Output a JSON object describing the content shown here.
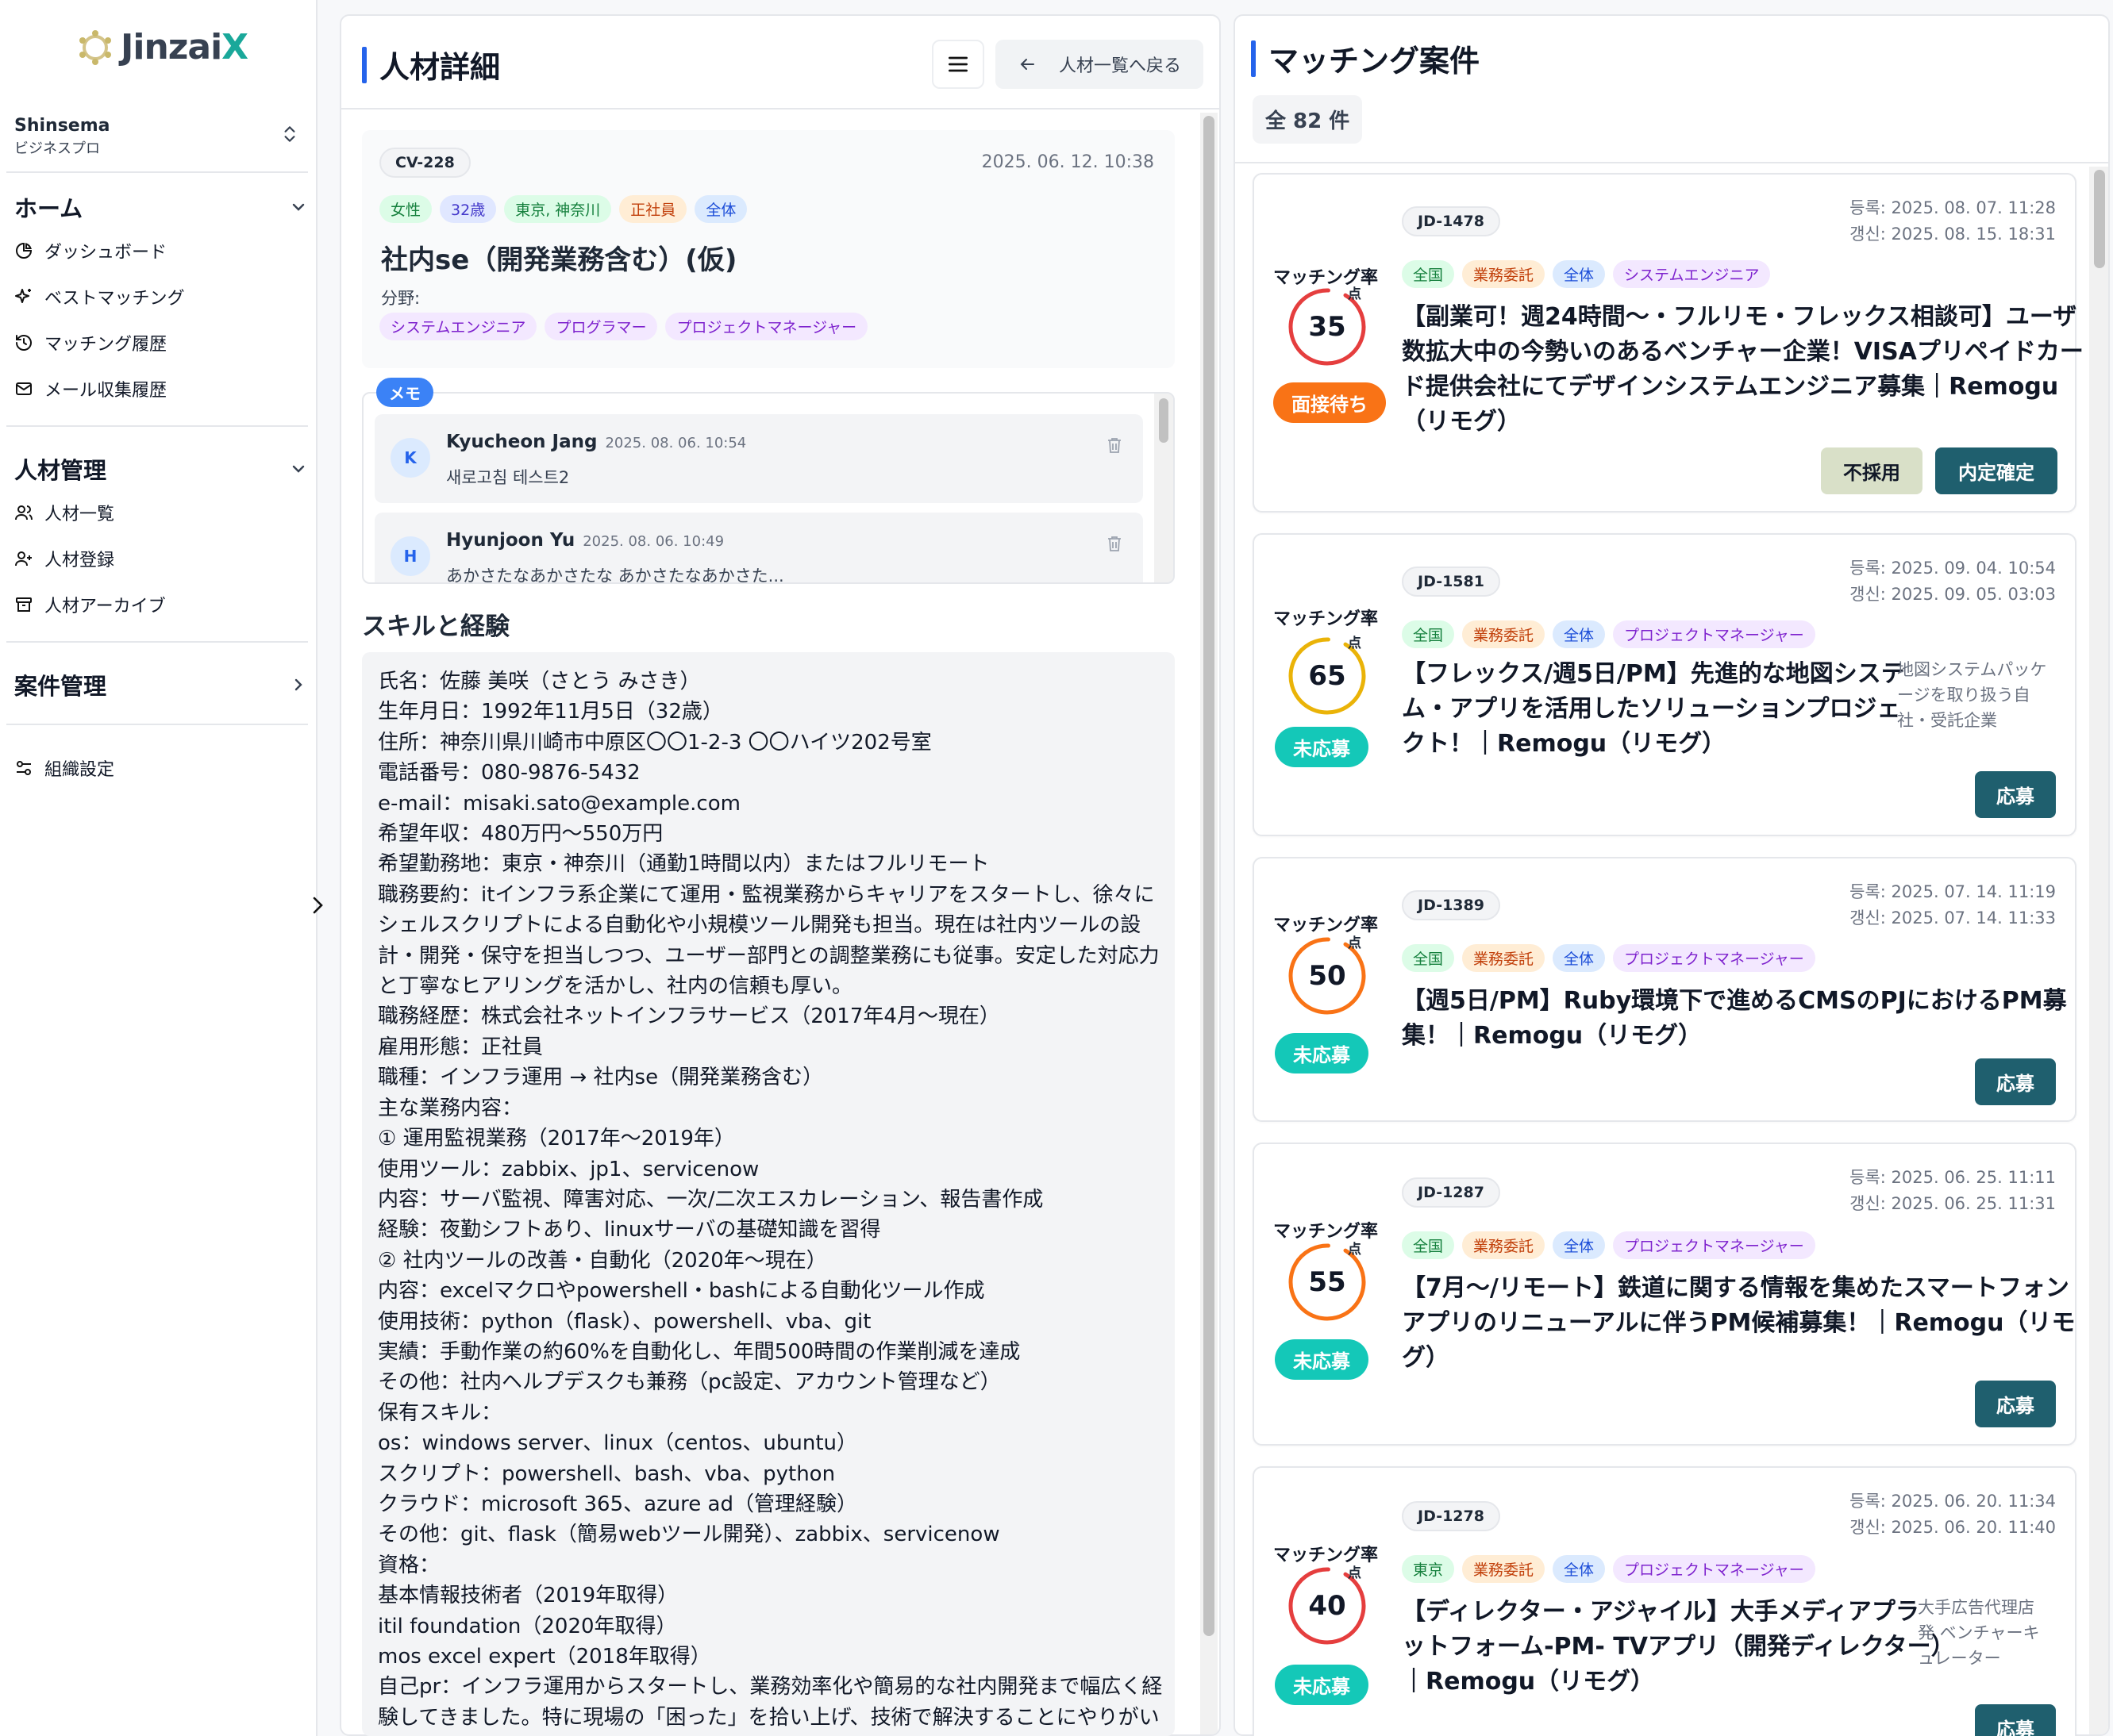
{
  "colors": {
    "accent": "#2563eb",
    "brand": "#1aa89a",
    "primary_button": "#1f5f6e",
    "status_orange": "#f97316",
    "status_teal": "#14c8b8",
    "ring_red": "#e53e3e",
    "ring_yellow": "#eab308",
    "ring_orange": "#f97316"
  },
  "sidebar": {
    "logo": {
      "text_main": "Jinzai",
      "text_accent": "X"
    },
    "org": {
      "name": "Shinsema",
      "plan": "ビジネスプロ"
    },
    "home": {
      "title": "ホーム",
      "items": [
        {
          "label": "ダッシュボード",
          "icon": "pie-chart-icon"
        },
        {
          "label": "ベストマッチング",
          "icon": "sparkles-icon"
        },
        {
          "label": "マッチング履歴",
          "icon": "history-icon"
        },
        {
          "label": "メール収集履歴",
          "icon": "mail-icon"
        }
      ]
    },
    "talent": {
      "title": "人材管理",
      "items": [
        {
          "label": "人材一覧",
          "icon": "users-icon"
        },
        {
          "label": "人材登録",
          "icon": "user-plus-icon"
        },
        {
          "label": "人材アーカイブ",
          "icon": "archive-icon"
        }
      ]
    },
    "projects": {
      "title": "案件管理"
    },
    "settings": {
      "label": "組織設定",
      "icon": "settings-sliders-icon"
    }
  },
  "detail": {
    "title": "人材詳細",
    "back_label": "人材一覧へ戻る",
    "profile": {
      "id": "CV-228",
      "datetime": "2025. 06. 12. 10:38",
      "tags": [
        "女性",
        "32歳",
        "東京, 神奈川",
        "正社員",
        "全体"
      ],
      "name": "社内se（開発業務含む）(仮)",
      "field_label": "分野:",
      "fields": [
        "システムエンジニア",
        "プログラマー",
        "プロジェクトマネージャー"
      ]
    },
    "memo_label": "メモ",
    "memos": [
      {
        "initial": "K",
        "author": "Kyucheon Jang",
        "time": "2025. 08. 06. 10:54",
        "body": "새로고침 테스트2"
      },
      {
        "initial": "H",
        "author": "Hyunjoon Yu",
        "time": "2025. 08. 06. 10:49",
        "body": "あかさたなあかさたな あかさたなあかさた..."
      }
    ],
    "skills_title": "スキルと経験",
    "skills_lines": [
      "氏名：佐藤 美咲（さとう みさき）",
      "生年月日：1992年11月5日（32歳）",
      "住所：神奈川県川崎市中原区〇〇1-2-3 〇〇ハイツ202号室",
      "電話番号：080-9876-5432",
      "e-mail：misaki.sato@example.com",
      "希望年収：480万円〜550万円",
      "希望勤務地：東京・神奈川（通勤1時間以内）またはフルリモート",
      "職務要約：itインフラ系企業にて運用・監視業務からキャリアをスタートし、徐々に",
      "シェルスクリプトによる自動化や小規模ツール開発も担当。現在は社内ツールの設",
      "計・開発・保守を担当しつつ、ユーザー部門との調整業務にも従事。安定した対応力",
      "と丁寧なヒアリングを活かし、社内の信頼も厚い。",
      "職務経歴：株式会社ネットインフラサービス（2017年4月〜現在）",
      "雇用形態：正社員",
      "職種：インフラ運用 → 社内se（開発業務含む）",
      "主な業務内容：",
      "① 運用監視業務（2017年〜2019年）",
      "使用ツール：zabbix、jp1、servicenow",
      "内容：サーバ監視、障害対応、一次/二次エスカレーション、報告書作成",
      "経験：夜勤シフトあり、linuxサーバの基礎知識を習得",
      "② 社内ツールの改善・自動化（2020年〜現在）",
      "内容：excelマクロやpowershell・bashによる自動化ツール作成",
      "使用技術：python（flask）、powershell、vba、git",
      "実績：手動作業の約60%を自動化し、年間500時間の作業削減を達成",
      "その他：社内ヘルプデスクも兼務（pc設定、アカウント管理など）",
      "保有スキル：",
      "os：windows server、linux（centos、ubuntu）",
      "スクリプト：powershell、bash、vba、python",
      "クラウド：microsoft 365、azure ad（管理経験）",
      "その他：git、flask（簡易webツール開発）、zabbix、servicenow",
      "資格：",
      "基本情報技術者（2019年取得）",
      "itil foundation（2020年取得）",
      "mos excel expert（2018年取得）",
      "自己pr：インフラ運用からスタートし、業務効率化や簡易的な社内開発まで幅広く経",
      "験してきました。特に現場の「困った」を拾い上げ、技術で解決することにやりがい"
    ]
  },
  "matching": {
    "title": "マッチング案件",
    "count_label": "全 82 件",
    "rate_label": "マッチング率",
    "point_unit": "点",
    "jobs": [
      {
        "id": "JD-1478",
        "reg": "등록: 2025. 08. 07. 11:28",
        "upd": "갱신: 2025. 08. 15. 18:31",
        "score": 35,
        "status": "面接待ち",
        "tags": [
          "全国",
          "業務委託",
          "全体",
          "システムエンジニア"
        ],
        "title_lines": [
          "【副業可！週24時間〜・フルリモ・フレックス相談可】ユーザ",
          "数拡大中の今勢いのあるベンチャー企業！VISAプリペイドカー",
          "ド提供会社にてデザインシステムエンジニア募集｜Remogu",
          "（リモグ）"
        ],
        "company_lines": [],
        "reject_label": "不採用",
        "offer_label": "内定確定"
      },
      {
        "id": "JD-1581",
        "reg": "등록: 2025. 09. 04. 10:54",
        "upd": "갱신: 2025. 09. 05. 03:03",
        "score": 65,
        "status": "未応募",
        "tags": [
          "全国",
          "業務委託",
          "全体",
          "プロジェクトマネージャー"
        ],
        "title_lines": [
          "【フレックス/週5日/PM】先進的な地図システ",
          "ム・アプリを活用したソリューションプロジェ",
          "クト！｜Remogu（リモグ）"
        ],
        "company_lines": [
          "地図システムパッケ",
          "ージを取り扱う自",
          "社・受託企業"
        ],
        "apply_label": "応募"
      },
      {
        "id": "JD-1389",
        "reg": "등록: 2025. 07. 14. 11:19",
        "upd": "갱신: 2025. 07. 14. 11:33",
        "score": 50,
        "status": "未応募",
        "tags": [
          "全国",
          "業務委託",
          "全体",
          "プロジェクトマネージャー"
        ],
        "title_lines": [
          "【週5日/PM】Ruby環境下で進めるCMSのPJにおけるPM募",
          "集！｜Remogu（リモグ）"
        ],
        "company_lines": [],
        "apply_label": "応募"
      },
      {
        "id": "JD-1287",
        "reg": "등록: 2025. 06. 25. 11:11",
        "upd": "갱신: 2025. 06. 25. 11:31",
        "score": 55,
        "status": "未応募",
        "tags": [
          "全国",
          "業務委託",
          "全体",
          "プロジェクトマネージャー"
        ],
        "title_lines": [
          "【7月〜/リモート】鉄道に関する情報を集めたスマートフォン",
          "アプリのリニューアルに伴うPM候補募集！｜Remogu（リモ",
          "グ）"
        ],
        "company_lines": [],
        "apply_label": "応募"
      },
      {
        "id": "JD-1278",
        "reg": "등록: 2025. 06. 20. 11:34",
        "upd": "갱신: 2025. 06. 20. 11:40",
        "score": 40,
        "status": "未応募",
        "tags": [
          "東京",
          "業務委託",
          "全体",
          "プロジェクトマネージャー"
        ],
        "title_lines": [
          "【ディレクター・アジャイル】大手メディアプラ",
          "ットフォーム-PM- TVアプリ（開発ディレクター）",
          "｜Remogu（リモグ）"
        ],
        "company_lines": [
          "大手広告代理店",
          "発 ベンチャーキ",
          "ュレーター"
        ],
        "apply_label": "応募"
      }
    ]
  }
}
